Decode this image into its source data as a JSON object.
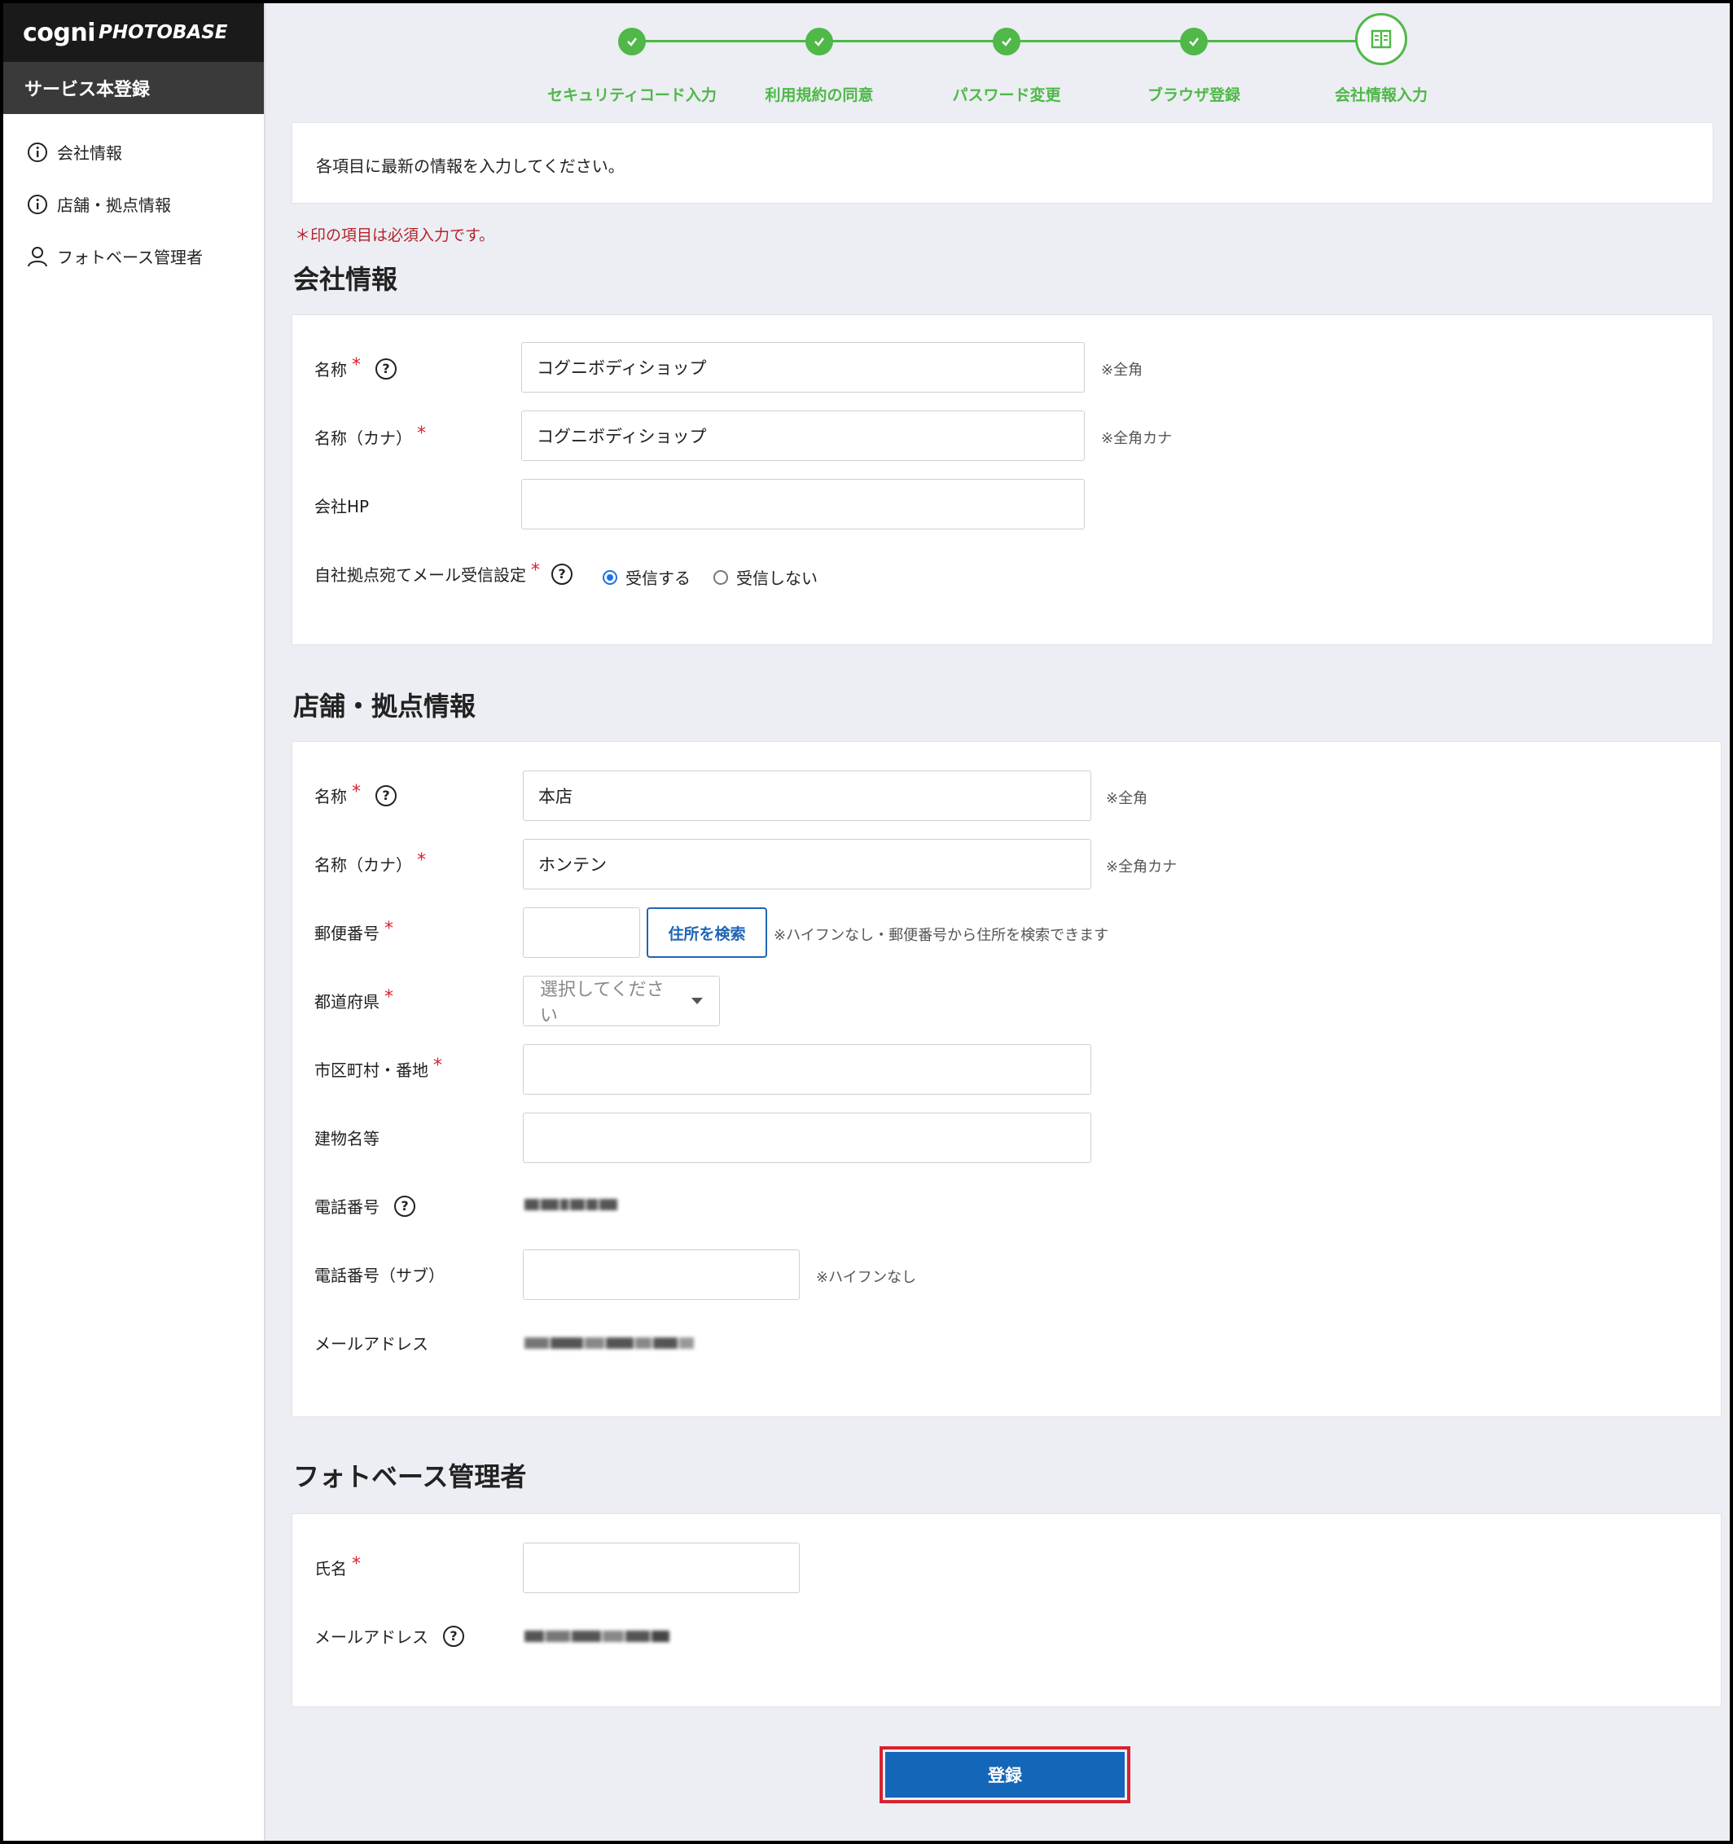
{
  "brand": {
    "logo_cogni": "cogni",
    "logo_photobase": "PHOTOBASE"
  },
  "sidebar": {
    "section_title": "サービス本登録",
    "items": [
      {
        "label": "会社情報",
        "icon": "info-icon"
      },
      {
        "label": "店舗・拠点情報",
        "icon": "info-icon"
      },
      {
        "label": "フォトベース管理者",
        "icon": "user-icon"
      }
    ]
  },
  "stepper": {
    "steps": [
      {
        "label": "セキュリティコード入力",
        "status": "done"
      },
      {
        "label": "利用規約の同意",
        "status": "done"
      },
      {
        "label": "パスワード変更",
        "status": "done"
      },
      {
        "label": "ブラウザ登録",
        "status": "done"
      },
      {
        "label": "会社情報入力",
        "status": "current"
      }
    ],
    "accent_color": "#4fb848"
  },
  "info": {
    "text": "各項目に最新の情報を入力してください。"
  },
  "required_note": "＊印の項目は必須入力です。",
  "company": {
    "title": "会社情報",
    "name_label": "名称",
    "name_value": "コグニボディショップ",
    "name_note": "※全角",
    "kana_label": "名称（カナ）",
    "kana_value": "コグニボディショップ",
    "kana_note": "※全角カナ",
    "hp_label": "会社HP",
    "hp_value": "",
    "mail_setting_label": "自社拠点宛てメール受信設定",
    "radio_receive": "受信する",
    "radio_not_receive": "受信しない"
  },
  "store": {
    "title": "店舗・拠点情報",
    "name_label": "名称",
    "name_value": "本店",
    "name_note": "※全角",
    "kana_label": "名称（カナ）",
    "kana_value": "ホンテン",
    "kana_note": "※全角カナ",
    "zip_label": "郵便番号",
    "zip_value": "",
    "zip_search_button": "住所を検索",
    "zip_note": "※ハイフンなし・郵便番号から住所を検索できます",
    "pref_label": "都道府県",
    "pref_placeholder": "選択してください",
    "city_label": "市区町村・番地",
    "building_label": "建物名等",
    "tel_label": "電話番号",
    "tel_sub_label": "電話番号（サブ）",
    "tel_sub_note": "※ハイフンなし",
    "email_label": "メールアドレス"
  },
  "admin": {
    "title": "フォトベース管理者",
    "name_label": "氏名",
    "email_label": "メールアドレス"
  },
  "required_mark": "*",
  "help_mark": "?",
  "submit": {
    "label": "登録"
  }
}
